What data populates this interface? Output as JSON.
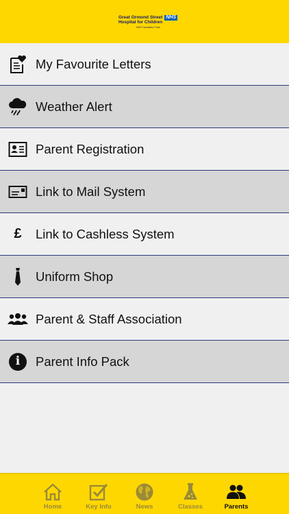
{
  "header": {
    "logo_line1": "Great Ormond Street",
    "logo_line2": "Hospital for Children",
    "logo_badge": "NHS",
    "logo_sub": "NHS Foundation Trust",
    "background": "#ffd700"
  },
  "menu": {
    "items": [
      {
        "label": "My Favourite Letters",
        "icon": "letter-heart-icon"
      },
      {
        "label": "Weather Alert",
        "icon": "rain-cloud-icon"
      },
      {
        "label": "Parent Registration",
        "icon": "id-card-icon"
      },
      {
        "label": "Link to Mail System",
        "icon": "envelope-card-icon"
      },
      {
        "label": "Link to Cashless System",
        "icon": "pound-icon"
      },
      {
        "label": "Uniform Shop",
        "icon": "tie-icon"
      },
      {
        "label": "Parent & Staff Association",
        "icon": "group-icon"
      },
      {
        "label": "Parent Info Pack",
        "icon": "info-icon"
      }
    ],
    "pound_symbol": "£",
    "info_symbol": "i"
  },
  "tabs": {
    "items": [
      {
        "label": "Home",
        "icon": "home-icon",
        "active": false
      },
      {
        "label": "Key Info",
        "icon": "checkbox-icon",
        "active": false
      },
      {
        "label": "News",
        "icon": "globe-icon",
        "active": false
      },
      {
        "label": "Classes",
        "icon": "flask-icon",
        "active": false
      },
      {
        "label": "Parents",
        "icon": "parents-icon",
        "active": true
      }
    ],
    "inactive_color": "#9a8a3a",
    "active_color": "#111111"
  }
}
